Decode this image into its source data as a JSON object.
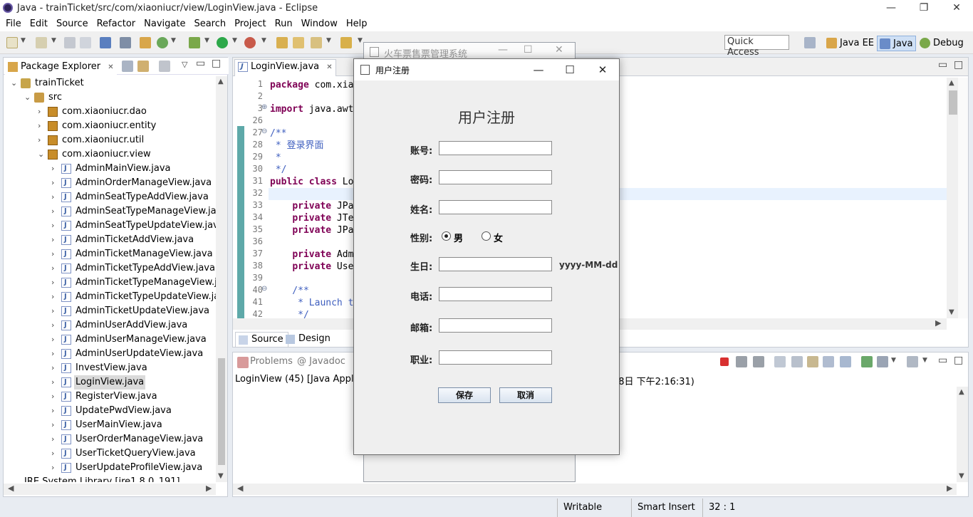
{
  "window": {
    "title": "Java - trainTicket/src/com/xiaoniucr/view/LoginView.java - Eclipse",
    "minimize": "—",
    "restore": "❐",
    "close": "✕"
  },
  "menu": [
    "File",
    "Edit",
    "Source",
    "Refactor",
    "Navigate",
    "Search",
    "Project",
    "Run",
    "Window",
    "Help"
  ],
  "toolbar": {
    "quick_access": "Quick Access",
    "perspectives": [
      "Java EE",
      "Java",
      "Debug"
    ]
  },
  "package_explorer": {
    "tab_label": "Package Explorer",
    "tab_close": "✕",
    "rows": [
      {
        "label": "trainTicket",
        "depth": 0,
        "expanded": true,
        "icon": "project-icon"
      },
      {
        "label": "src",
        "depth": 1,
        "expanded": true,
        "icon": "source-folder-icon"
      },
      {
        "label": "com.xiaoniucr.dao",
        "depth": 2,
        "expanded": false,
        "icon": "package-icon"
      },
      {
        "label": "com.xiaoniucr.entity",
        "depth": 2,
        "expanded": false,
        "icon": "package-icon"
      },
      {
        "label": "com.xiaoniucr.util",
        "depth": 2,
        "expanded": false,
        "icon": "package-icon"
      },
      {
        "label": "com.xiaoniucr.view",
        "depth": 2,
        "expanded": true,
        "icon": "package-icon"
      },
      {
        "label": "AdminMainView.java",
        "depth": 3,
        "icon": "java-file-icon"
      },
      {
        "label": "AdminOrderManageView.java",
        "depth": 3,
        "icon": "java-file-icon"
      },
      {
        "label": "AdminSeatTypeAddView.java",
        "depth": 3,
        "icon": "java-file-icon"
      },
      {
        "label": "AdminSeatTypeManageView.java",
        "depth": 3,
        "icon": "java-file-icon"
      },
      {
        "label": "AdminSeatTypeUpdateView.java",
        "depth": 3,
        "icon": "java-file-icon"
      },
      {
        "label": "AdminTicketAddView.java",
        "depth": 3,
        "icon": "java-file-icon"
      },
      {
        "label": "AdminTicketManageView.java",
        "depth": 3,
        "icon": "java-file-icon"
      },
      {
        "label": "AdminTicketTypeAddView.java",
        "depth": 3,
        "icon": "java-file-icon"
      },
      {
        "label": "AdminTicketTypeManageView.java",
        "depth": 3,
        "icon": "java-file-icon"
      },
      {
        "label": "AdminTicketTypeUpdateView.java",
        "depth": 3,
        "icon": "java-file-icon"
      },
      {
        "label": "AdminTicketUpdateView.java",
        "depth": 3,
        "icon": "java-file-icon"
      },
      {
        "label": "AdminUserAddView.java",
        "depth": 3,
        "icon": "java-file-icon"
      },
      {
        "label": "AdminUserManageView.java",
        "depth": 3,
        "icon": "java-file-icon"
      },
      {
        "label": "AdminUserUpdateView.java",
        "depth": 3,
        "icon": "java-file-icon"
      },
      {
        "label": "InvestView.java",
        "depth": 3,
        "icon": "java-file-icon"
      },
      {
        "label": "LoginView.java",
        "depth": 3,
        "icon": "java-file-icon",
        "selected": true
      },
      {
        "label": "RegisterView.java",
        "depth": 3,
        "icon": "java-file-icon"
      },
      {
        "label": "UpdatePwdView.java",
        "depth": 3,
        "icon": "java-file-icon"
      },
      {
        "label": "UserMainView.java",
        "depth": 3,
        "icon": "java-file-icon"
      },
      {
        "label": "UserOrderManageView.java",
        "depth": 3,
        "icon": "java-file-icon"
      },
      {
        "label": "UserTicketQueryView.java",
        "depth": 3,
        "icon": "java-file-icon"
      },
      {
        "label": "UserUpdateProfileView.java",
        "depth": 3,
        "icon": "java-file-icon"
      }
    ],
    "partial_row": "JRE System Library [jre1.8.0_191]"
  },
  "editor": {
    "tab_label": "LoginView.java",
    "tab_close": "✕",
    "lines": [
      {
        "n": "1",
        "code": "package com.xia",
        "kind": "kw-first"
      },
      {
        "n": "2",
        "code": "",
        "kind": "plain"
      },
      {
        "n": "3",
        "code": "import java.awt",
        "kind": "kw-first",
        "fold": "⊕"
      },
      {
        "n": "26",
        "code": "",
        "kind": "plain"
      },
      {
        "n": "27",
        "code": "/**",
        "kind": "comment",
        "fold": "⊖"
      },
      {
        "n": "28",
        "code": " * 登录界面",
        "kind": "comment"
      },
      {
        "n": "29",
        "code": " *",
        "kind": "comment"
      },
      {
        "n": "30",
        "code": " */",
        "kind": "comment"
      },
      {
        "n": "31",
        "code": "public class Lo",
        "kind": "kw-two"
      },
      {
        "n": "32",
        "code": "",
        "kind": "current"
      },
      {
        "n": "33",
        "code": "    private JPa",
        "kind": "kw-first"
      },
      {
        "n": "34",
        "code": "    private JTe",
        "kind": "kw-first"
      },
      {
        "n": "35",
        "code": "    private JPa",
        "kind": "kw-first"
      },
      {
        "n": "36",
        "code": "",
        "kind": "plain"
      },
      {
        "n": "37",
        "code": "    private Adm",
        "kind": "kw-first"
      },
      {
        "n": "38",
        "code": "    private Use",
        "kind": "kw-first"
      },
      {
        "n": "39",
        "code": "",
        "kind": "plain"
      },
      {
        "n": "40",
        "code": "    /**",
        "kind": "comment",
        "fold": "⊖"
      },
      {
        "n": "41",
        "code": "     * Launch t",
        "kind": "comment"
      },
      {
        "n": "42",
        "code": "     */",
        "kind": "comment"
      }
    ],
    "bottom_tabs": [
      "Source",
      "Design"
    ]
  },
  "console": {
    "tabs": [
      "Problems",
      "@ Javadoc"
    ],
    "line_left": "LoginView (45) [Java Applicat",
    "line_right": "18日 下午2:16:31)"
  },
  "status_bar": {
    "writable": "Writable",
    "insert_mode": "Smart Insert",
    "position": "32 : 1"
  },
  "background_window": {
    "title": "火车票售票管理系统"
  },
  "dialog": {
    "window_title": "用户注册",
    "heading": "用户注册",
    "fields": [
      {
        "label": "账号:",
        "value": "",
        "name": "account"
      },
      {
        "label": "密码:",
        "value": "",
        "name": "password"
      },
      {
        "label": "姓名:",
        "value": "",
        "name": "name"
      },
      {
        "label": "生日:",
        "value": "",
        "name": "birthday",
        "hint": "yyyy-MM-dd"
      },
      {
        "label": "电话:",
        "value": "",
        "name": "phone"
      },
      {
        "label": "邮箱:",
        "value": "",
        "name": "email"
      },
      {
        "label": "职业:",
        "value": "",
        "name": "occupation"
      }
    ],
    "gender": {
      "label": "性别:",
      "options": [
        "男",
        "女"
      ],
      "selected": "男"
    },
    "save_label": "保存",
    "cancel_label": "取消",
    "min": "—",
    "max": "☐",
    "close": "✕"
  }
}
